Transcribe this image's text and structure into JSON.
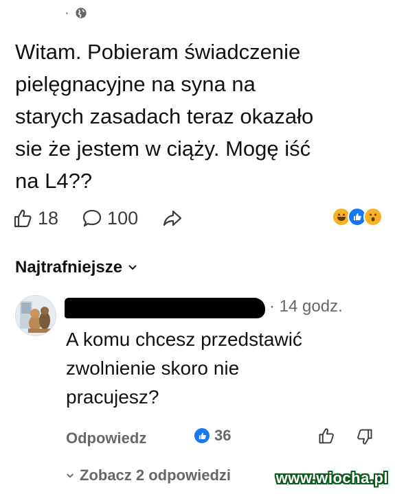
{
  "post": {
    "meta_separator": "·",
    "privacy_icon": "globe-icon",
    "text": "Witam. Pobieram świadczenie\npielęgnacyjne na syna na\nstarych zasadach teraz okazało\nsie że jestem w ciąży. Mogę iść\nna L4??",
    "likes": "18",
    "comments": "100",
    "reaction_icons": [
      "haha-reaction-icon",
      "like-reaction-icon",
      "wow-reaction-icon"
    ]
  },
  "comments_section": {
    "sort_label": "Najtrafniejsze"
  },
  "comment": {
    "timestamp": "· 14 godz.",
    "text": "A komu chcesz przedstawić\nzwolnienie skoro nie\npracujesz?",
    "reply_label": "Odpowiedz",
    "like_count": "36",
    "see_replies_label": "Zobacz 2 odpowiedzi"
  },
  "watermark": "www.wiocha.pl",
  "colors": {
    "text": "#1c1e21",
    "secondary": "#65676b",
    "like_blue": "#1877f2",
    "watermark_outline": "#0d5a1a"
  }
}
